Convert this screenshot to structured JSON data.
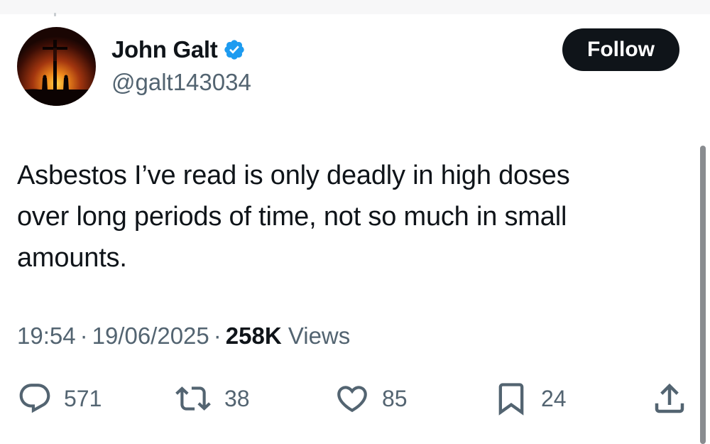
{
  "author": {
    "name": "John Galt",
    "handle": "@galt143034",
    "verified": true,
    "avatar_icon": "crucifixion-sunset-avatar"
  },
  "follow_button": {
    "label": "Follow"
  },
  "tweet": {
    "text_lines": [
      "Asbestos I’ve read is only deadly in high doses",
      "over long periods of time, not so much in small",
      "amounts."
    ],
    "time": "19:54",
    "date": "19/06/2025",
    "separator": "·",
    "views_count": "258K",
    "views_label": "Views"
  },
  "actions": {
    "replies": {
      "icon": "reply-icon",
      "count": "571"
    },
    "reposts": {
      "icon": "repost-icon",
      "count": "38"
    },
    "likes": {
      "icon": "heart-icon",
      "count": "85"
    },
    "bookmarks": {
      "icon": "bookmark-icon",
      "count": "24"
    },
    "share": {
      "icon": "share-icon"
    }
  },
  "colors": {
    "text_primary": "#0f1419",
    "text_secondary": "#536471",
    "verified_blue": "#1d9bf0",
    "button_bg": "#0f1419",
    "icon_gray": "#536471"
  }
}
